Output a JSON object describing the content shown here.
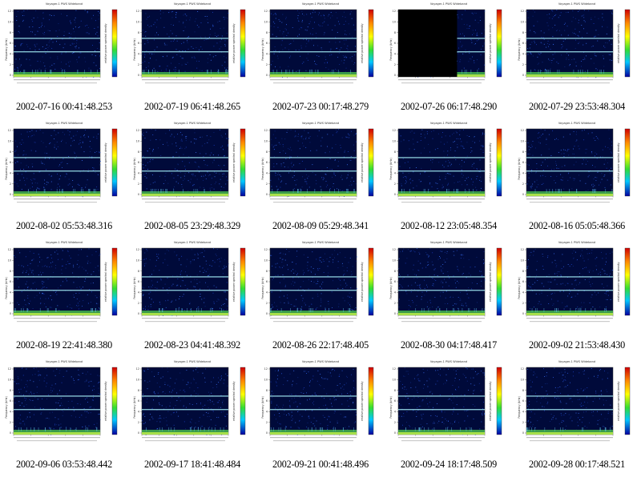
{
  "thumb_title": "Voyager-1 PWS Wideband",
  "y_axis_label": "Frequency (kHz)",
  "colorbar_label": "relative power spectral density",
  "y_ticks": [
    "12",
    "10",
    "8",
    "6",
    "4",
    "2",
    "0"
  ],
  "colors": {
    "background": "#ffffff",
    "spectrogram_bg": "#000a3a",
    "band_line": "#9fe6f0",
    "noise_floor": "#a8e04a"
  },
  "thumbnails": [
    {
      "caption": "2002-07-16 00:41:48.253",
      "gap": false
    },
    {
      "caption": "2002-07-19 06:41:48.265",
      "gap": false
    },
    {
      "caption": "2002-07-23 00:17:48.279",
      "gap": false
    },
    {
      "caption": "2002-07-26 06:17:48.290",
      "gap": true
    },
    {
      "caption": "2002-07-29 23:53:48.304",
      "gap": false
    },
    {
      "caption": "2002-08-02 05:53:48.316",
      "gap": false
    },
    {
      "caption": "2002-08-05 23:29:48.329",
      "gap": false
    },
    {
      "caption": "2002-08-09 05:29:48.341",
      "gap": false
    },
    {
      "caption": "2002-08-12 23:05:48.354",
      "gap": false
    },
    {
      "caption": "2002-08-16 05:05:48.366",
      "gap": false
    },
    {
      "caption": "2002-08-19 22:41:48.380",
      "gap": false
    },
    {
      "caption": "2002-08-23 04:41:48.392",
      "gap": false
    },
    {
      "caption": "2002-08-26 22:17:48.405",
      "gap": false
    },
    {
      "caption": "2002-08-30 04:17:48.417",
      "gap": false
    },
    {
      "caption": "2002-09-02 21:53:48.430",
      "gap": false
    },
    {
      "caption": "2002-09-06 03:53:48.442",
      "gap": false
    },
    {
      "caption": "2002-09-17 18:41:48.484",
      "gap": false
    },
    {
      "caption": "2002-09-21 00:41:48.496",
      "gap": false
    },
    {
      "caption": "2002-09-24 18:17:48.509",
      "gap": false
    },
    {
      "caption": "2002-09-28 00:17:48.521",
      "gap": false
    }
  ]
}
